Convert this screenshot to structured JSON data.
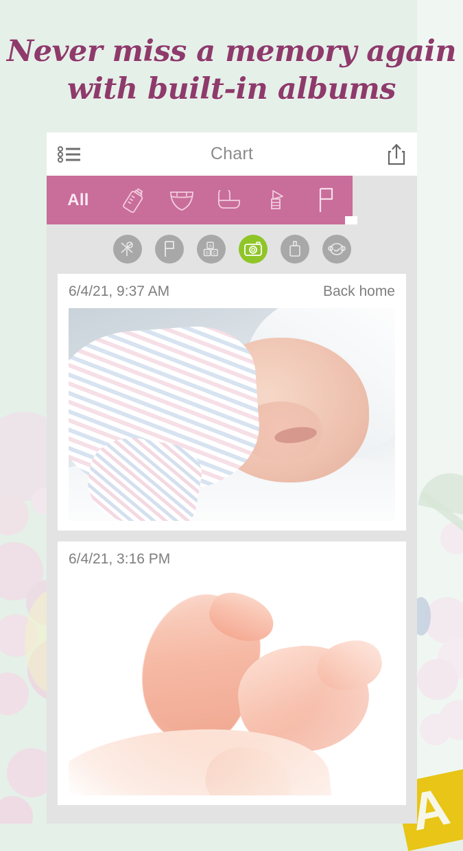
{
  "promo": {
    "headline_line1": "Never miss a memory again",
    "headline_line2": "with built-in albums",
    "headline_color": "#8e3a6b",
    "background_color": "#e4f0e8",
    "corner_letter": "A"
  },
  "app": {
    "navbar": {
      "title": "Chart",
      "left_icon": "list-icon",
      "right_icon": "share-icon"
    },
    "filter_bar": {
      "background_color": "#c96d9b",
      "selected_index": 5,
      "items": [
        {
          "label": "All",
          "icon": "text-all"
        },
        {
          "label": "Feeding",
          "icon": "baby-bottle-icon"
        },
        {
          "label": "Diaper",
          "icon": "diaper-icon"
        },
        {
          "label": "Bath",
          "icon": "bathtub-icon"
        },
        {
          "label": "Pumping",
          "icon": "breast-pump-icon"
        },
        {
          "label": "Milestone",
          "icon": "flag-icon"
        }
      ]
    },
    "quick_actions": {
      "background_color": "#e3e3e3",
      "inactive_color": "#a8a8a8",
      "active_color": "#8fc528",
      "items": [
        {
          "label": "Nail care",
          "icon": "nail-clipper-icon",
          "active": false
        },
        {
          "label": "Milestone",
          "icon": "flag-icon",
          "active": false
        },
        {
          "label": "Activity",
          "icon": "abc-blocks-icon",
          "active": false
        },
        {
          "label": "Photo",
          "icon": "camera-icon",
          "active": true
        },
        {
          "label": "Medicine",
          "icon": "medicine-bottle-icon",
          "active": false
        },
        {
          "label": "Baby",
          "icon": "baby-face-icon",
          "active": false
        }
      ]
    },
    "entries": [
      {
        "date": "6/4/21, 9:37 AM",
        "note": "Back home",
        "photo": "sleeping-newborn-in-striped-hat"
      },
      {
        "date": "6/4/21, 3:16 PM",
        "note": "",
        "photo": "baby-feet-held-in-hand"
      }
    ]
  }
}
